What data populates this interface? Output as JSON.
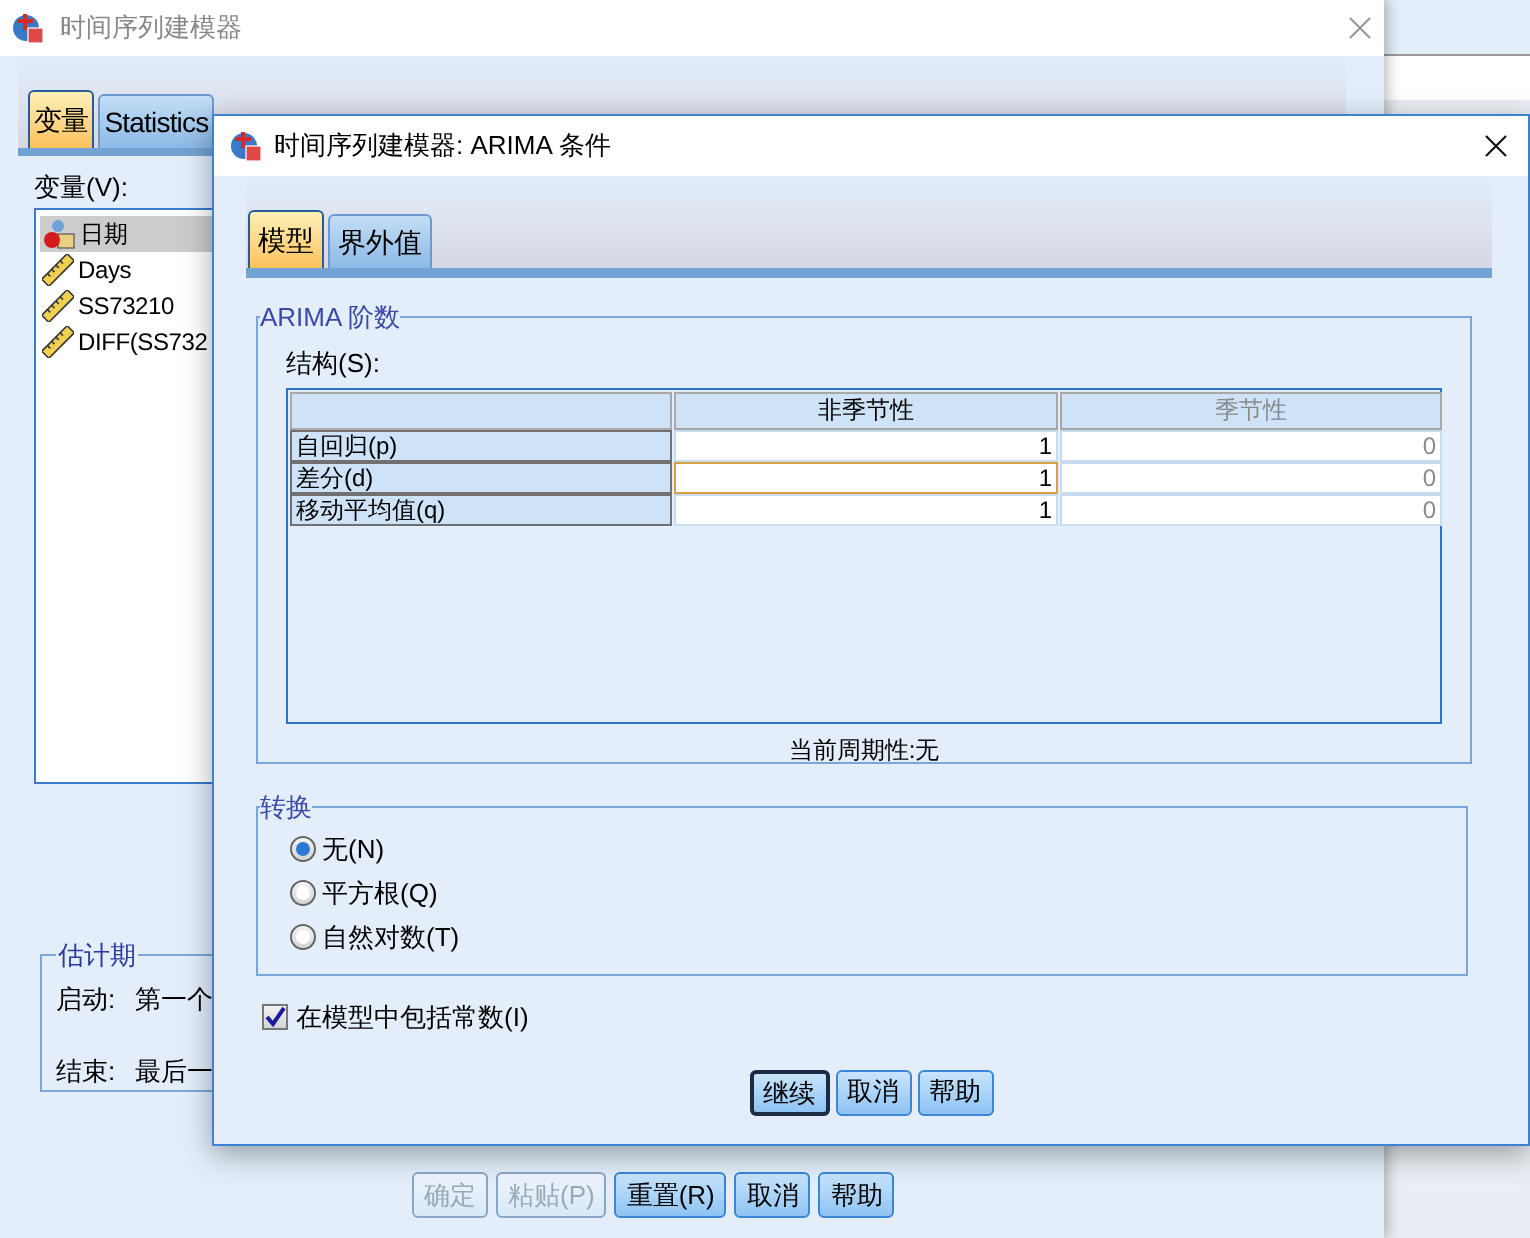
{
  "background_window": {
    "title": "时间序列建模器",
    "tabs": [
      {
        "label": "变量",
        "selected": true
      },
      {
        "label": "Statistics",
        "selected": false
      }
    ],
    "variables_label": "变量(V):",
    "variables": [
      {
        "name": "日期",
        "kind": "date",
        "selected": true
      },
      {
        "name": "Days",
        "kind": "scale",
        "selected": false
      },
      {
        "name": "SS73210",
        "kind": "scale",
        "selected": false
      },
      {
        "name": "DIFF(SS732",
        "kind": "scale",
        "selected": false
      }
    ],
    "estimation_period": {
      "title": "估计期",
      "rows": [
        {
          "label": "启动:",
          "value": "第一个"
        },
        {
          "label": "结束:",
          "value": "最后一"
        }
      ]
    },
    "buttons": [
      {
        "label": "确定",
        "disabled": true
      },
      {
        "label": "粘贴(P)",
        "disabled": true
      },
      {
        "label": "重置(R)",
        "disabled": false
      },
      {
        "label": "取消",
        "disabled": false
      },
      {
        "label": "帮助",
        "disabled": false
      }
    ]
  },
  "dialog": {
    "title": "时间序列建模器: ARIMA 条件",
    "tabs": [
      {
        "label": "模型",
        "selected": true
      },
      {
        "label": "界外值",
        "selected": false
      }
    ],
    "arima": {
      "title": "ARIMA 阶数",
      "structure_label": "结构(S):",
      "columns": [
        {
          "label": "非季节性",
          "disabled": false
        },
        {
          "label": "季节性",
          "disabled": true
        }
      ],
      "rows": [
        {
          "label": "自回归(p)",
          "values": [
            "1",
            "0"
          ],
          "focused": false
        },
        {
          "label": "差分(d)",
          "values": [
            "1",
            "0"
          ],
          "focused": true
        },
        {
          "label": "移动平均值(q)",
          "values": [
            "1",
            "0"
          ],
          "focused": false
        }
      ],
      "periodicity": "当前周期性:无"
    },
    "transform": {
      "title": "转换",
      "options": [
        {
          "label": "无(N)",
          "selected": true
        },
        {
          "label": "平方根(Q)",
          "selected": false
        },
        {
          "label": "自然对数(T)",
          "selected": false
        }
      ]
    },
    "constant": {
      "label": "在模型中包括常数(I)",
      "checked": true
    },
    "buttons": [
      {
        "label": "继续",
        "default": true
      },
      {
        "label": "取消",
        "default": false
      },
      {
        "label": "帮助",
        "default": false
      }
    ]
  }
}
